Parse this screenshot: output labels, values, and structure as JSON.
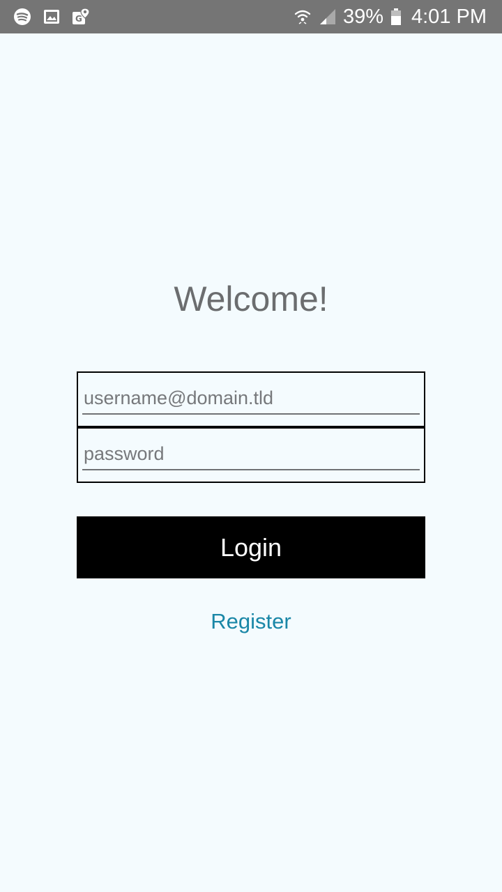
{
  "status_bar": {
    "left_icons": [
      "spotify-icon",
      "gallery-icon",
      "maps-icon"
    ],
    "right_icons": [
      "wifi-icon",
      "signal-icon",
      "battery-icon"
    ],
    "battery": "39%",
    "time": "4:01 PM",
    "colors": {
      "background": "#757575",
      "foreground": "#ffffff"
    }
  },
  "main": {
    "title": "Welcome!",
    "username": {
      "value": "",
      "placeholder": "username@domain.tld"
    },
    "password": {
      "value": "",
      "placeholder": "password"
    },
    "login_label": "Login",
    "register_label": "Register"
  },
  "colors": {
    "page_background": "#f4fbfe",
    "title": "#6b6d6f",
    "button_background": "#000000",
    "button_text": "#ffffff",
    "link": "#1a87a7"
  }
}
